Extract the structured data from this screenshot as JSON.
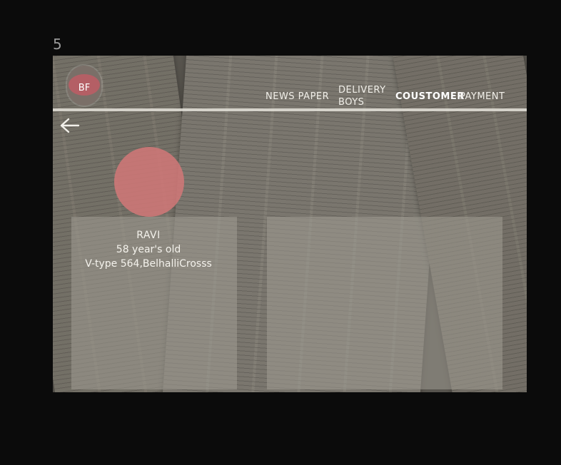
{
  "page_number": "5",
  "logo": {
    "text": "BF"
  },
  "nav": {
    "items": [
      {
        "label": "NEWS PAPER"
      },
      {
        "label": "DELIVERY BOYS"
      },
      {
        "label": "COUSTOMER"
      },
      {
        "label": "PAYMENT"
      }
    ],
    "active": "COUSTOMER"
  },
  "icons": {
    "back": "arrow-left-icon"
  },
  "customer": {
    "name": "RAVI",
    "age": "58 year's old",
    "address": "V-type 564,BelhalliCrosss"
  },
  "colors": {
    "background": "#0b0b0b",
    "avatar": "#d27878",
    "nav_text": "#f1efe9"
  }
}
